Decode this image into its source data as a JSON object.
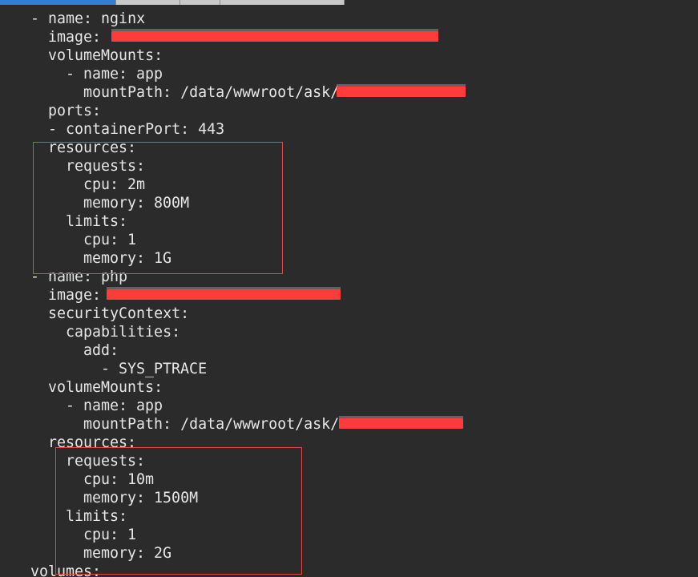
{
  "editor": {
    "tabs": [
      {
        "label": "",
        "active": true
      },
      {
        "label": "",
        "active": false
      },
      {
        "label": "",
        "active": false
      },
      {
        "label": "",
        "active": false
      }
    ],
    "lines": [
      "- name: nginx",
      "image: ",
      "volumeMounts:",
      "- name: app",
      "mountPath: /data/wwwroot/ask/",
      "ports:",
      "- containerPort: 443",
      "resources:",
      "requests:",
      "cpu: 2m",
      "memory: 800M",
      "limits:",
      "cpu: 1",
      "memory: 1G",
      "- name: php",
      "image: ",
      "securityContext:",
      "capabilities:",
      "add:",
      "- SYS_PTRACE",
      "volumeMounts:",
      "- name: app",
      "mountPath: /data/wwwroot/ask/",
      "resources:",
      "requests:",
      "cpu: 10m",
      "memory: 1500M",
      "limits:",
      "cpu: 1",
      "memory: 2G",
      "volumes:"
    ]
  },
  "colors": {
    "background": "#2b2b2b",
    "text": "#e6e6e6",
    "redaction": "#ff3b3b",
    "annotation_box": "#e34848",
    "active_tab": "#2f7fd8"
  }
}
